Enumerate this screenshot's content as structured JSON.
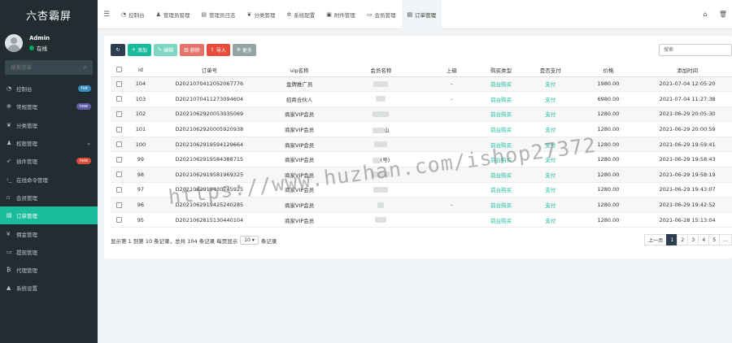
{
  "brand": {
    "title": "六杏霸屏"
  },
  "user": {
    "name": "Admin",
    "status": "在线"
  },
  "sidebar": {
    "search_placeholder": "搜索菜单",
    "items": [
      {
        "label": "控制台",
        "icon": "dashboard-icon",
        "badge": "hot"
      },
      {
        "label": "常规管理",
        "icon": "gears-icon",
        "badge": "new"
      },
      {
        "label": "分类管理",
        "icon": "leaf-icon",
        "badge": ""
      },
      {
        "label": "权限管理",
        "icon": "group-icon",
        "badge": "",
        "caret": "⌄"
      },
      {
        "label": "插件管理",
        "icon": "rocket-icon",
        "badge": "new"
      },
      {
        "label": "在线命令管理",
        "icon": "terminal-icon",
        "badge": ""
      },
      {
        "label": "会员管理",
        "icon": "user-icon",
        "badge": ""
      },
      {
        "label": "订单管理",
        "icon": "list-icon",
        "badge": "",
        "active": true
      },
      {
        "label": "佣金管理",
        "icon": "yen-icon",
        "badge": ""
      },
      {
        "label": "提现管理",
        "icon": "credit-card-icon",
        "badge": ""
      },
      {
        "label": "代理管理",
        "icon": "bitcoin-icon",
        "badge": ""
      },
      {
        "label": "系统设置",
        "icon": "warning-icon",
        "badge": ""
      }
    ]
  },
  "topbar": {
    "tabs": [
      {
        "label": "控制台",
        "icon": "dashboard-icon"
      },
      {
        "label": "管理员管理",
        "icon": "user-icon"
      },
      {
        "label": "管理员日志",
        "icon": "list-icon"
      },
      {
        "label": "分类管理",
        "icon": "leaf-icon"
      },
      {
        "label": "系统配置",
        "icon": "gear-icon"
      },
      {
        "label": "附件管理",
        "icon": "image-icon"
      },
      {
        "label": "会员管理",
        "icon": "user-icon"
      },
      {
        "label": "订单管理",
        "icon": "list-icon",
        "active": true
      }
    ]
  },
  "toolbar": {
    "add": "添加",
    "edit": "编辑",
    "delete": "删除",
    "import": "导入",
    "more": "更多",
    "search_placeholder": "搜索"
  },
  "table": {
    "headers": [
      "Id",
      "订单号",
      "vip名称",
      "会员名称",
      "上级",
      "购买类型",
      "是否支付",
      "价格",
      "添加时间"
    ],
    "rows": [
      {
        "id": "104",
        "order": "D2021070412052067776",
        "vip": "金牌推广员",
        "member": "",
        "parent": "-",
        "type": "前台购买",
        "paid": "支付",
        "price": "1980.00",
        "time": "2021-07-04 12:05:20"
      },
      {
        "id": "103",
        "order": "D2021070411273094604",
        "vip": "招商合伙人",
        "member": "",
        "parent": "-",
        "type": "前台购买",
        "paid": "支付",
        "price": "6980.00",
        "time": "2021-07-04 11:27:38"
      },
      {
        "id": "102",
        "order": "D2021062920053035069",
        "vip": "商家VIP会员",
        "member": "",
        "parent": "",
        "type": "前台购买",
        "paid": "支付",
        "price": "1280.00",
        "time": "2021-06-29 20:05:30"
      },
      {
        "id": "101",
        "order": "D2021062920005920938",
        "vip": "商家VIP会员",
        "member": "山",
        "parent": "",
        "type": "前台购买",
        "paid": "支付",
        "price": "1280.00",
        "time": "2021-06-29 20:00:59"
      },
      {
        "id": "100",
        "order": "D2021062919594129664",
        "vip": "商家VIP会员",
        "member": "",
        "parent": "",
        "type": "前台购买",
        "paid": "支付",
        "price": "1280.00",
        "time": "2021-06-29 19:59:41"
      },
      {
        "id": "99",
        "order": "D2021062919584388715",
        "vip": "商家VIP会员",
        "member": "(号)",
        "parent": "",
        "type": "前台购买",
        "paid": "支付",
        "price": "1280.00",
        "time": "2021-06-29 19:58:43"
      },
      {
        "id": "98",
        "order": "D2021062919581969325",
        "vip": "商家VIP会员",
        "member": "",
        "parent": "",
        "type": "前台购买",
        "paid": "支付",
        "price": "1280.00",
        "time": "2021-06-29 19:58:19"
      },
      {
        "id": "97",
        "order": "D2021062919430745925",
        "vip": "商家VIP会员",
        "member": "",
        "parent": "",
        "type": "前台购买",
        "paid": "支付",
        "price": "1280.00",
        "time": "2021-06-29 19:43:07"
      },
      {
        "id": "96",
        "order": "D2021062919425240285",
        "vip": "商家VIP会员",
        "member": "",
        "parent": "-",
        "type": "前台购买",
        "paid": "支付",
        "price": "1280.00",
        "time": "2021-06-29 19:42:52"
      },
      {
        "id": "95",
        "order": "D2021062815130440104",
        "vip": "商家VIP会员",
        "member": "",
        "parent": "",
        "type": "前台购买",
        "paid": "支付",
        "price": "1280.00",
        "time": "2021-06-28 15:13:04"
      }
    ]
  },
  "footer": {
    "summary_prefix": "显示第 1 到第 10 条记录，总共 104 条记录 每页显示",
    "page_size": "10",
    "summary_suffix": "条记录",
    "prev": "上一页",
    "pages": [
      "1",
      "2",
      "3",
      "4",
      "5",
      "..."
    ]
  },
  "watermark": "https://www.huzhan.com/ishop27372"
}
